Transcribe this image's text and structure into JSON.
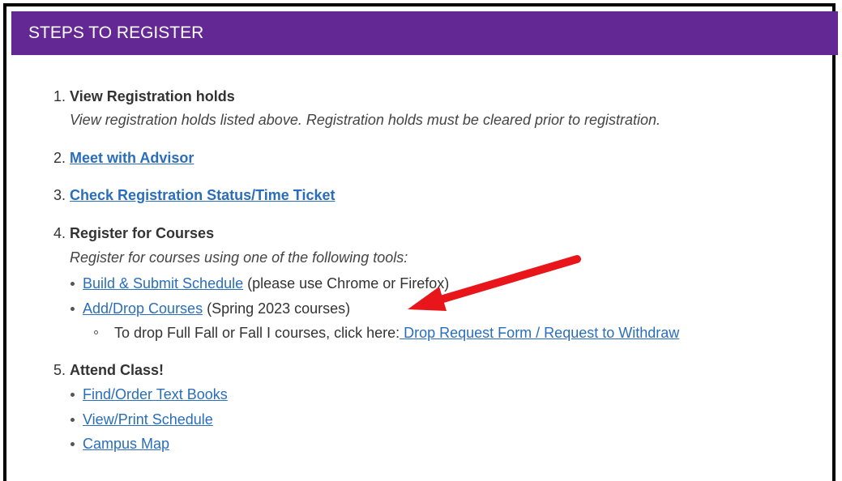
{
  "header": {
    "title": "STEPS TO REGISTER"
  },
  "steps": {
    "s1": {
      "number": "1.",
      "title": "View Registration holds",
      "description": "View registration holds listed above. Registration holds must be cleared prior to registration."
    },
    "s2": {
      "number": "2.",
      "link": "Meet with Advisor"
    },
    "s3": {
      "number": "3.",
      "link": "Check Registration Status/Time Ticket"
    },
    "s4": {
      "number": "4.",
      "title": "Register for Courses",
      "description": "Register for courses using one of the following tools:",
      "items": [
        {
          "link": "Build & Submit Schedule",
          "note": " (please use Chrome or Firefox)"
        },
        {
          "link": "Add/Drop Courses",
          "note": " (Spring 2023 courses)"
        }
      ],
      "subitem": {
        "text": "To drop Full Fall or Fall I courses, click here:",
        "link": " Drop Request Form / Request to Withdraw"
      }
    },
    "s5": {
      "number": "5.",
      "title": "Attend Class!",
      "items": [
        {
          "link": "Find/Order Text Books"
        },
        {
          "link": "View/Print Schedule"
        },
        {
          "link": "Campus Map"
        }
      ]
    }
  },
  "annotation": {
    "arrow_color": "#e8151b"
  },
  "colors": {
    "header_bg": "#632894",
    "link": "#2a6ebb",
    "text": "#333333"
  }
}
